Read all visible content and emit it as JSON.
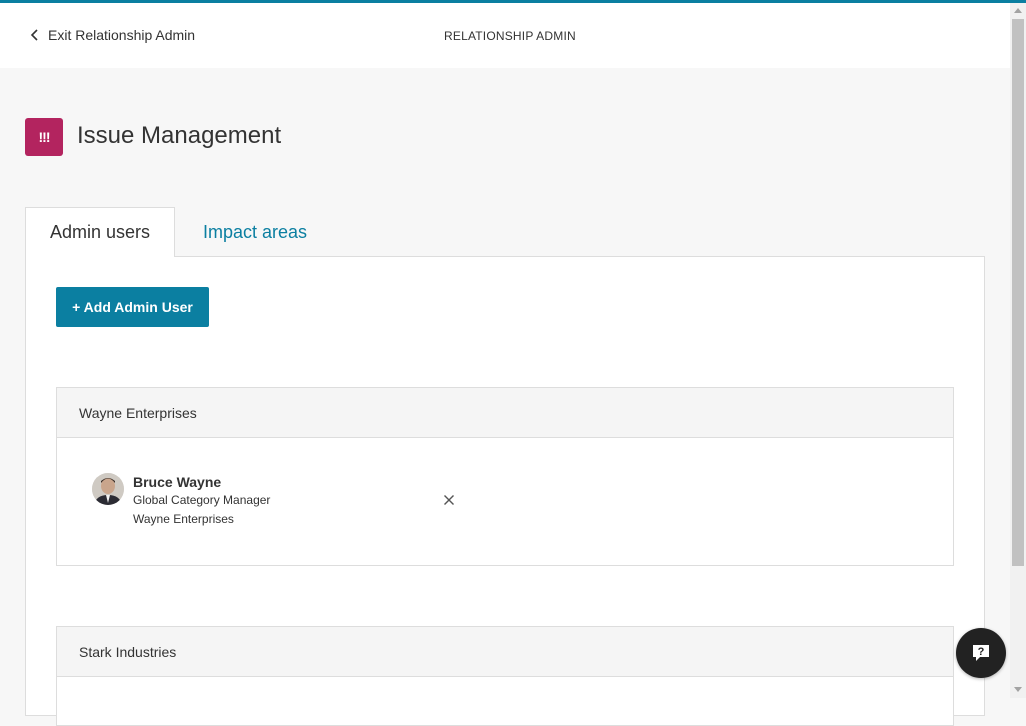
{
  "header": {
    "exit_label": "Exit Relationship Admin",
    "title": "RELATIONSHIP ADMIN"
  },
  "page": {
    "icon_text": "!!!",
    "title": "Issue Management",
    "accent_color": "#b3245f"
  },
  "tabs": [
    {
      "label": "Admin users",
      "active": true
    },
    {
      "label": "Impact areas",
      "active": false
    }
  ],
  "add_button_label": "+ Add Admin User",
  "groups": [
    {
      "name": "Wayne Enterprises",
      "users": [
        {
          "name": "Bruce Wayne",
          "role": "Global Category Manager",
          "company": "Wayne Enterprises"
        }
      ]
    },
    {
      "name": "Stark Industries",
      "users": []
    }
  ],
  "help_label": "?",
  "colors": {
    "brand": "#0b7fa1",
    "module": "#b3245f"
  }
}
